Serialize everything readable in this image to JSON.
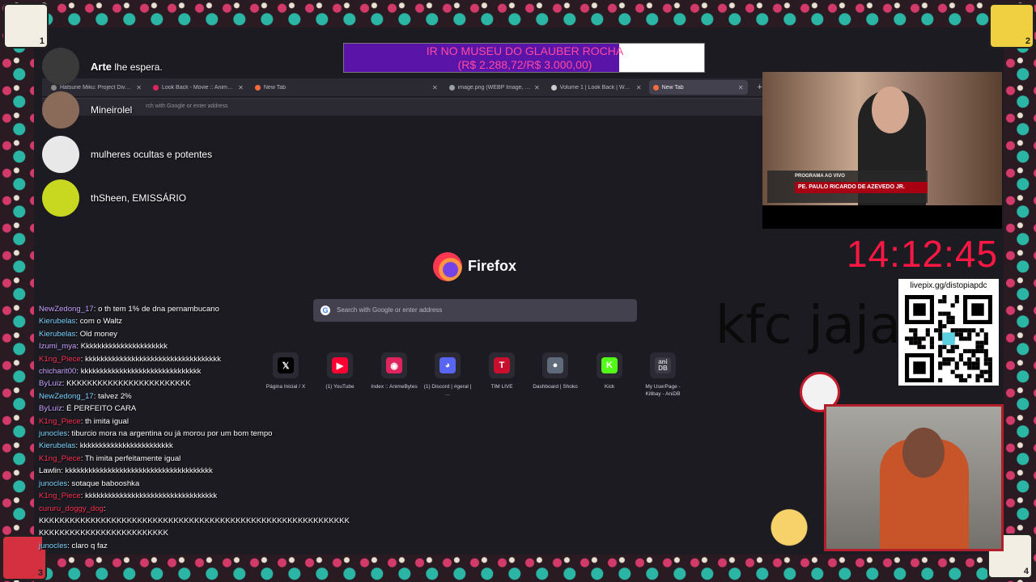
{
  "goal": {
    "text_line1": "IR NO MUSEU DO GLAUBER ROCHA",
    "text_line2": "(R$ 2.288,72/R$ 3.000,00)",
    "progress": 0.763
  },
  "browser": {
    "tabs": [
      {
        "title": "Hatsune Miku: Project Diva 2nd",
        "color": "#888888"
      },
      {
        "title": "Look Back - Movie :: AnimeBytes",
        "color": "#e0245e"
      },
      {
        "title": "New Tab",
        "color": "#ff6a3d"
      },
      {
        "title": "image.png (WEBP Image, 497 × 3…",
        "color": "#9aa0a6"
      },
      {
        "title": "Volume 1 | Look Back | Weekly",
        "color": "#cccccc"
      },
      {
        "title": "New Tab",
        "color": "#ff6a3d",
        "active": true
      }
    ],
    "urlbar_placeholder": "rch with Google or enter address",
    "brand": "Firefox",
    "search_placeholder": "Search with Google or enter address",
    "shortcuts": [
      {
        "label": "Página Inicial / X",
        "glyph": "𝕏",
        "color": "#000000"
      },
      {
        "label": "(1) YouTube",
        "glyph": "▶",
        "color": "#ff0033"
      },
      {
        "label": "Index :: AnimeBytes",
        "glyph": "◉",
        "color": "#e0245e"
      },
      {
        "label": "(1) Discord | #geral | …",
        "glyph": "◕",
        "color": "#5865f2"
      },
      {
        "label": "TIM LIVE",
        "glyph": "T",
        "color": "#c8102e"
      },
      {
        "label": "Dashboard | Shoko",
        "glyph": "●",
        "color": "#5f6b7a"
      },
      {
        "label": "Kick",
        "glyph": "K",
        "color": "#53fc18"
      },
      {
        "label": "My UserPage - Killbay - AniDB",
        "glyph": "ani DB",
        "color": "#3a3944"
      }
    ]
  },
  "alerts": [
    {
      "name": "Arte",
      "text": "lhe espera."
    },
    {
      "name": "",
      "text": "Mineirolel"
    },
    {
      "name": "",
      "text": "mulheres ocultas e potentes"
    },
    {
      "name": "",
      "text": "thSheen, EMISSÁRIO"
    }
  ],
  "chat": [
    {
      "user": "NewZedong_17",
      "text": "o th tem 1% de dna pernambucano",
      "color": "#c8a2ff"
    },
    {
      "user": "Kierubelas",
      "text": "com o Waltz",
      "color": "#7fd4ff"
    },
    {
      "user": "Kierubelas",
      "text": "Old money",
      "color": "#7fd4ff"
    },
    {
      "user": "Izumi_mya",
      "text": "Kkkkkkkkkkkkkkkkkkkkkk",
      "color": "#c8a2ff"
    },
    {
      "user": "K1ng_Piece",
      "text": "kkkkkkkkkkkkkkkkkkkkkkkkkkkkkkkkkkk",
      "color": "#ff3355"
    },
    {
      "user": "chicharit00",
      "text": "kkkkkkkkkkkkkkkkkkkkkkkkkkkkkkk",
      "color": "#c8a2ff"
    },
    {
      "user": "ByLuiz",
      "text": "KKKKKKKKKKKKKKKKKKKKKKKK",
      "color": "#c8a2ff"
    },
    {
      "user": "NewZedong_17",
      "text": "talvez 2%",
      "color": "#7fd4ff"
    },
    {
      "user": "ByLuiz",
      "text": "É PERFEITO CARA",
      "color": "#c8a2ff"
    },
    {
      "user": "K1ng_Piece",
      "text": "th imita igual",
      "color": "#ff3355"
    },
    {
      "user": "junocles",
      "text": "tiburcio mora na argentina ou já morou por um bom tempo",
      "color": "#7fd4ff"
    },
    {
      "user": "Kierubelas",
      "text": "kkkkkkkkkkkkkkkkkkkkkkkk",
      "color": "#7fd4ff"
    },
    {
      "user": "K1ng_Piece",
      "text": "Th imita perfeitamente igual",
      "color": "#ff3355"
    },
    {
      "user": "Lawlin",
      "text": "kkkkkkkkkkkkkkkkkkkkkkkkkkkkkkkkkkkkkk",
      "color": "#ffffff"
    },
    {
      "user": "junocles",
      "text": "sotaque babooshka",
      "color": "#7fd4ff"
    },
    {
      "user": "K1ng_Piece",
      "text": "kkkkkkkkkkkkkkkkkkkkkkkkkkkkkkkkkk",
      "color": "#ff3355"
    },
    {
      "user": "cururu_doggy_dog",
      "text": "",
      "color": "#ff3355"
    },
    {
      "user": "",
      "text": "KKKKKKKKKKKKKKKKKKKKKKKKKKKKKKKKKKKKKKKKKKKKKKKKKKKKKKKKKKKK",
      "color": "#ffffff"
    },
    {
      "user": "",
      "text": "KKKKKKKKKKKKKKKKKKKKKKKKK",
      "color": "#ffffff"
    },
    {
      "user": "junocles",
      "text": "claro q faz",
      "color": "#7fd4ff"
    }
  ],
  "video": {
    "program_label": "PROGRAMA AO VIVO",
    "host_name": "PE. PAULO RICARDO DE AZEVEDO JR."
  },
  "clock": "14:12:45",
  "caption": "kfc jaja",
  "qr": {
    "url": "livepix.gg/distopiapdc"
  },
  "corners": [
    "1",
    "2",
    "3",
    "4"
  ],
  "colors": {
    "accent": "#ff1744",
    "goal_fill": "#5b14a8",
    "goal_text": "#ff4aa2",
    "browser_bg": "#1c1b22"
  }
}
